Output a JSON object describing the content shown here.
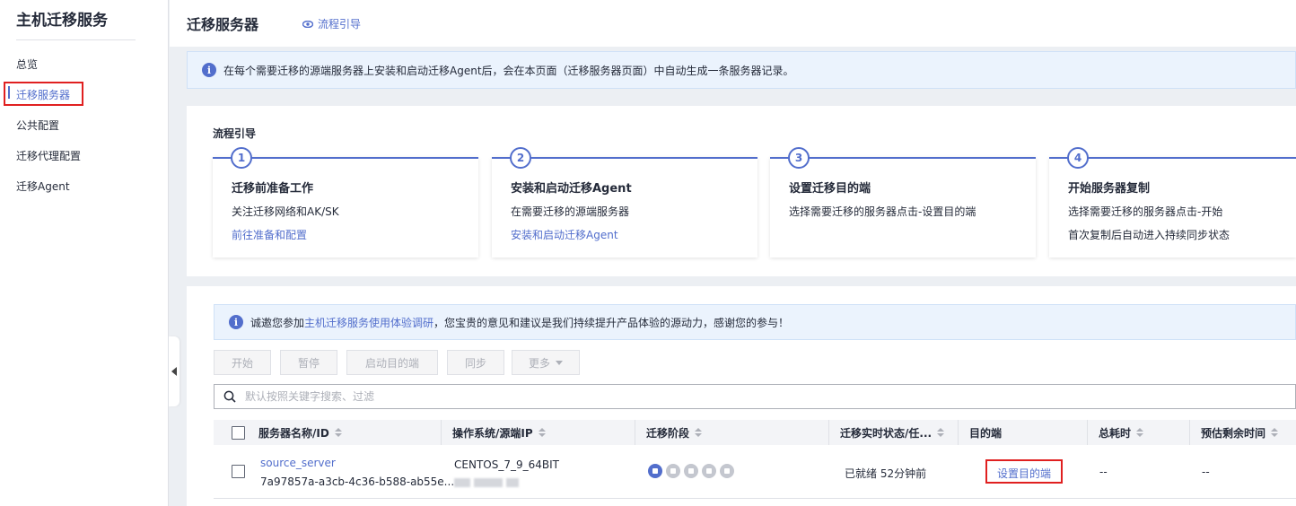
{
  "sidebar": {
    "title": "主机迁移服务",
    "items": [
      {
        "label": "总览"
      },
      {
        "label": "迁移服务器"
      },
      {
        "label": "公共配置"
      },
      {
        "label": "迁移代理配置"
      },
      {
        "label": "迁移Agent"
      }
    ]
  },
  "header": {
    "title": "迁移服务器",
    "guide_link": "流程引导"
  },
  "info_banner": {
    "text": "在每个需要迁移的源端服务器上安装和启动迁移Agent后，会在本页面（迁移服务器页面）中自动生成一条服务器记录。"
  },
  "process": {
    "title": "流程引导",
    "steps": [
      {
        "num": "1",
        "title": "迁移前准备工作",
        "desc": "关注迁移网络和AK/SK",
        "link": "前往准备和配置"
      },
      {
        "num": "2",
        "title": "安装和启动迁移Agent",
        "desc": "在需要迁移的源端服务器",
        "link": "安装和启动迁移Agent"
      },
      {
        "num": "3",
        "title": "设置迁移目的端",
        "desc": "选择需要迁移的服务器点击-设置目的端"
      },
      {
        "num": "4",
        "title": "开始服务器复制",
        "desc": "选择需要迁移的服务器点击-开始",
        "desc2": "首次复制后自动进入持续同步状态"
      }
    ]
  },
  "survey": {
    "prefix": "诚邀您参加",
    "link": "主机迁移服务使用体验调研",
    "suffix": "，您宝贵的意见和建议是我们持续提升产品体验的源动力，感谢您的参与！"
  },
  "toolbar": {
    "start": "开始",
    "pause": "暂停",
    "start_target": "启动目的端",
    "sync": "同步",
    "more": "更多"
  },
  "search": {
    "placeholder": "默认按照关键字搜索、过滤"
  },
  "table": {
    "columns": {
      "name": "服务器名称/ID",
      "os": "操作系统/源端IP",
      "stage": "迁移阶段",
      "status": "迁移实时状态/任...",
      "target": "目的端",
      "elapsed": "总耗时",
      "remaining": "预估剩余时间"
    },
    "rows": [
      {
        "name": "source_server",
        "id": "7a97857a-a3cb-4c36-b588-ab55e...",
        "os": "CENTOS_7_9_64BIT",
        "status": "已就绪 52分钟前",
        "target": "设置目的端",
        "elapsed": "--",
        "remaining": "--"
      }
    ]
  },
  "colors": {
    "accent": "#526ecc",
    "highlight": "#e02020"
  }
}
